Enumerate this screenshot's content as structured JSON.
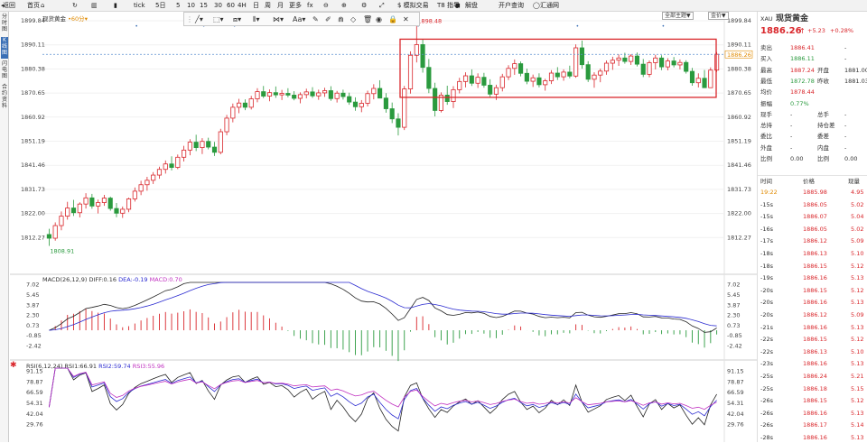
{
  "topbar": {
    "items": [
      "返回",
      "首页",
      "",
      "",
      "",
      "tick",
      "5日",
      "5",
      "10",
      "15",
      "30",
      "60",
      "4H",
      "日",
      "周",
      "月",
      "更多",
      "fx",
      "",
      "",
      "",
      "$ 模拟交易",
      "T8 指导",
      "解盘",
      "开户查询",
      "汇通网"
    ]
  },
  "left_tabs": [
    "分时图",
    "K线图",
    "闪电图",
    "合约资料"
  ],
  "chart": {
    "title": "现货黄金",
    "period": "60分",
    "price_axis": [
      "1899.84",
      "1890.11",
      "1880.38",
      "1870.65",
      "1860.92",
      "1851.19",
      "1841.46",
      "1831.73",
      "1822.00",
      "1812.27"
    ],
    "price_range": [
      1808.0,
      1899.84
    ],
    "current_price_tag": "1886.26",
    "high_label": "1898.48",
    "low_label": "1808.91",
    "select_main": "全部主题",
    "select_second": "金价"
  },
  "macd": {
    "label_name": "MACD(26,12,9)",
    "diff": "DIFF:0.16",
    "dea": "DEA:-0.19",
    "macd": "MACD:0.70",
    "axis": [
      "7.02",
      "5.45",
      "3.87",
      "2.30",
      "0.73",
      "-0.85",
      "-2.42"
    ],
    "range": [
      -3.2,
      7.4
    ]
  },
  "rsi": {
    "label_name": "RSI(6,12,24)",
    "rsi1": "RSI1:66.91",
    "rsi2": "RSI2:59.74",
    "rsi3": "RSI3:55.96",
    "axis": [
      "91.15",
      "78.87",
      "66.59",
      "54.31",
      "42.04",
      "29.76"
    ],
    "range": [
      22,
      95
    ]
  },
  "quote": {
    "code": "XAU",
    "name": "现货黄金",
    "price": "1886.26",
    "arrow": "↑",
    "change": "+5.23",
    "change_pct": "+0.28%",
    "rows": [
      {
        "l1": "卖出",
        "v1": "1886.41",
        "l2": "",
        "v2": "-"
      },
      {
        "l1": "买入",
        "v1": "1886.11",
        "l2": "",
        "v2": "-"
      },
      {
        "l1": "最高",
        "v1": "1887.24",
        "l2": "开盘",
        "v2": "1881.00"
      },
      {
        "l1": "最低",
        "v1": "1872.78",
        "l2": "昨收",
        "v2": "1881.03"
      },
      {
        "l1": "均价",
        "v1": "1878.44",
        "l2": "",
        "v2": ""
      },
      {
        "l1": "振幅",
        "v1": "0.77%",
        "l2": "",
        "v2": ""
      },
      {
        "l1": "现手",
        "v1": "-",
        "l2": "总手",
        "v2": "-"
      },
      {
        "l1": "总持",
        "v1": "-",
        "l2": "持仓差",
        "v2": "-"
      },
      {
        "l1": "委比",
        "v1": "-",
        "l2": "委差",
        "v2": "-"
      },
      {
        "l1": "外盘",
        "v1": "-",
        "l2": "内盘",
        "v2": "-"
      },
      {
        "l1": "比例",
        "v1": "0.00",
        "l2": "比例",
        "v2": "0.00"
      }
    ],
    "tick_headers": [
      "时间",
      "价格",
      "现量"
    ],
    "ticks": [
      {
        "t": "19:22",
        "p": "1885.98",
        "v": "4.95"
      },
      {
        "t": "-15s",
        "p": "1886.05",
        "v": "5.02"
      },
      {
        "t": "-15s",
        "p": "1886.07",
        "v": "5.04"
      },
      {
        "t": "-16s",
        "p": "1886.05",
        "v": "5.02"
      },
      {
        "t": "-17s",
        "p": "1886.12",
        "v": "5.09"
      },
      {
        "t": "-18s",
        "p": "1886.13",
        "v": "5.10"
      },
      {
        "t": "-18s",
        "p": "1886.15",
        "v": "5.12"
      },
      {
        "t": "-19s",
        "p": "1886.16",
        "v": "5.13"
      },
      {
        "t": "-20s",
        "p": "1886.15",
        "v": "5.12"
      },
      {
        "t": "-20s",
        "p": "1886.16",
        "v": "5.13"
      },
      {
        "t": "-20s",
        "p": "1886.12",
        "v": "5.09"
      },
      {
        "t": "-21s",
        "p": "1886.16",
        "v": "5.13"
      },
      {
        "t": "-22s",
        "p": "1886.15",
        "v": "5.12"
      },
      {
        "t": "-22s",
        "p": "1886.13",
        "v": "5.10"
      },
      {
        "t": "-23s",
        "p": "1886.16",
        "v": "5.13"
      },
      {
        "t": "-25s",
        "p": "1886.24",
        "v": "5.21"
      },
      {
        "t": "-25s",
        "p": "1886.18",
        "v": "5.15"
      },
      {
        "t": "-26s",
        "p": "1886.15",
        "v": "5.12"
      },
      {
        "t": "-26s",
        "p": "1886.16",
        "v": "5.13"
      },
      {
        "t": "-26s",
        "p": "1886.17",
        "v": "5.14"
      },
      {
        "t": "-28s",
        "p": "1886.16",
        "v": "5.13"
      }
    ]
  },
  "colors": {
    "up": "#d9262b",
    "down": "#2a9a3e",
    "highlight_box": "#d9262b",
    "diff_line": "#222222",
    "dea_line": "#2a2ad0"
  },
  "chart_data": {
    "type": "candlestick",
    "series": [
      {
        "name": "price",
        "ohlc": [
          [
            1813.5,
            1815.8,
            1808.9,
            1812.0
          ],
          [
            1812.0,
            1818.4,
            1811.0,
            1817.1
          ],
          [
            1817.1,
            1822.8,
            1815.2,
            1820.9
          ],
          [
            1820.9,
            1826.7,
            1819.5,
            1824.2
          ],
          [
            1824.2,
            1827.5,
            1821.0,
            1822.3
          ],
          [
            1822.3,
            1826.5,
            1820.4,
            1825.8
          ],
          [
            1825.8,
            1830.2,
            1824.0,
            1828.3
          ],
          [
            1828.3,
            1829.9,
            1823.9,
            1825.0
          ],
          [
            1825.0,
            1827.6,
            1822.0,
            1826.4
          ],
          [
            1826.4,
            1829.5,
            1825.1,
            1828.2
          ],
          [
            1828.2,
            1828.8,
            1823.1,
            1824.0
          ],
          [
            1824.0,
            1826.2,
            1820.5,
            1822.1
          ],
          [
            1822.1,
            1824.8,
            1820.2,
            1823.7
          ],
          [
            1823.7,
            1828.4,
            1822.5,
            1827.9
          ],
          [
            1827.9,
            1832.5,
            1826.8,
            1831.0
          ],
          [
            1831.0,
            1835.2,
            1829.4,
            1833.6
          ],
          [
            1833.6,
            1836.8,
            1831.2,
            1835.4
          ],
          [
            1835.4,
            1838.7,
            1833.9,
            1837.5
          ],
          [
            1837.5,
            1840.9,
            1836.0,
            1839.8
          ],
          [
            1839.8,
            1843.4,
            1838.1,
            1842.0
          ],
          [
            1842.0,
            1845.1,
            1839.4,
            1840.6
          ],
          [
            1840.6,
            1845.8,
            1839.9,
            1844.7
          ],
          [
            1844.7,
            1849.3,
            1843.0,
            1847.6
          ],
          [
            1847.6,
            1852.0,
            1845.5,
            1850.8
          ],
          [
            1850.8,
            1853.8,
            1847.2,
            1848.6
          ],
          [
            1848.6,
            1852.4,
            1846.0,
            1851.1
          ],
          [
            1851.1,
            1852.6,
            1847.9,
            1848.8
          ],
          [
            1848.8,
            1850.9,
            1845.2,
            1846.7
          ],
          [
            1846.7,
            1856.2,
            1845.9,
            1855.0
          ],
          [
            1855.0,
            1861.8,
            1853.6,
            1860.5
          ],
          [
            1860.5,
            1866.4,
            1858.8,
            1864.9
          ],
          [
            1864.9,
            1868.3,
            1862.5,
            1866.6
          ],
          [
            1866.6,
            1868.1,
            1863.7,
            1864.9
          ],
          [
            1864.9,
            1869.5,
            1864.0,
            1868.3
          ],
          [
            1868.3,
            1872.6,
            1866.9,
            1871.2
          ],
          [
            1871.2,
            1873.5,
            1868.6,
            1869.4
          ],
          [
            1869.4,
            1872.1,
            1867.3,
            1870.8
          ],
          [
            1870.8,
            1873.3,
            1868.7,
            1869.9
          ],
          [
            1869.9,
            1871.9,
            1867.8,
            1870.5
          ],
          [
            1870.5,
            1872.6,
            1868.9,
            1869.8
          ],
          [
            1869.8,
            1871.4,
            1867.7,
            1868.5
          ],
          [
            1868.5,
            1870.9,
            1866.5,
            1870.0
          ],
          [
            1870.0,
            1872.4,
            1868.5,
            1871.1
          ],
          [
            1871.1,
            1873.0,
            1868.7,
            1869.5
          ],
          [
            1869.5,
            1872.0,
            1867.9,
            1870.7
          ],
          [
            1870.7,
            1872.8,
            1869.1,
            1871.6
          ],
          [
            1871.6,
            1873.4,
            1867.5,
            1868.4
          ],
          [
            1868.4,
            1871.5,
            1866.8,
            1870.6
          ],
          [
            1870.6,
            1872.0,
            1868.0,
            1869.2
          ],
          [
            1869.2,
            1870.8,
            1865.9,
            1867.0
          ],
          [
            1867.0,
            1868.9,
            1863.5,
            1865.1
          ],
          [
            1865.1,
            1867.8,
            1862.9,
            1866.5
          ],
          [
            1866.5,
            1871.6,
            1865.2,
            1870.4
          ],
          [
            1870.4,
            1874.2,
            1868.1,
            1872.5
          ],
          [
            1872.5,
            1875.8,
            1870.2,
            1868.6
          ],
          [
            1868.6,
            1870.6,
            1862.7,
            1864.3
          ],
          [
            1864.3,
            1866.8,
            1858.5,
            1860.2
          ],
          [
            1860.2,
            1862.5,
            1853.5,
            1856.8
          ],
          [
            1856.8,
            1873.5,
            1855.7,
            1872.3
          ],
          [
            1872.3,
            1887.5,
            1870.4,
            1885.9
          ],
          [
            1885.9,
            1898.5,
            1883.0,
            1890.2
          ],
          [
            1890.2,
            1892.5,
            1878.9,
            1881.0
          ],
          [
            1881.0,
            1884.4,
            1870.6,
            1872.5
          ],
          [
            1872.5,
            1874.8,
            1861.2,
            1863.6
          ],
          [
            1863.6,
            1870.9,
            1862.8,
            1869.8
          ],
          [
            1869.8,
            1873.6,
            1865.9,
            1867.2
          ],
          [
            1867.2,
            1873.4,
            1864.6,
            1872.0
          ],
          [
            1872.0,
            1876.8,
            1870.5,
            1875.3
          ],
          [
            1875.3,
            1879.0,
            1872.9,
            1877.6
          ],
          [
            1877.6,
            1880.2,
            1873.5,
            1874.6
          ],
          [
            1874.6,
            1878.6,
            1872.7,
            1877.0
          ],
          [
            1877.0,
            1878.8,
            1872.8,
            1873.8
          ],
          [
            1873.8,
            1876.2,
            1868.8,
            1870.2
          ],
          [
            1870.2,
            1874.0,
            1867.8,
            1872.8
          ],
          [
            1872.8,
            1878.4,
            1871.3,
            1877.2
          ],
          [
            1877.2,
            1881.9,
            1875.9,
            1880.6
          ],
          [
            1880.6,
            1884.2,
            1878.0,
            1882.5
          ],
          [
            1882.5,
            1883.4,
            1877.4,
            1878.6
          ],
          [
            1878.6,
            1880.5,
            1874.2,
            1875.4
          ],
          [
            1875.4,
            1878.1,
            1873.1,
            1876.8
          ],
          [
            1876.8,
            1878.6,
            1872.9,
            1874.0
          ],
          [
            1874.0,
            1876.4,
            1871.6,
            1875.6
          ],
          [
            1875.6,
            1879.9,
            1874.3,
            1878.7
          ],
          [
            1878.7,
            1881.1,
            1875.9,
            1877.2
          ],
          [
            1877.2,
            1880.2,
            1875.6,
            1879.1
          ],
          [
            1879.1,
            1881.7,
            1876.6,
            1877.5
          ],
          [
            1877.5,
            1890.3,
            1876.8,
            1888.9
          ],
          [
            1888.9,
            1891.8,
            1880.5,
            1882.1
          ],
          [
            1882.1,
            1883.5,
            1875.1,
            1876.2
          ],
          [
            1876.2,
            1879.0,
            1872.8,
            1877.9
          ],
          [
            1877.9,
            1880.5,
            1875.0,
            1879.5
          ],
          [
            1879.5,
            1883.8,
            1878.0,
            1882.7
          ],
          [
            1882.7,
            1885.3,
            1880.0,
            1883.9
          ],
          [
            1883.9,
            1886.2,
            1881.6,
            1884.8
          ],
          [
            1884.8,
            1886.9,
            1882.5,
            1883.4
          ],
          [
            1883.4,
            1886.3,
            1882.0,
            1885.6
          ],
          [
            1885.6,
            1887.0,
            1881.4,
            1882.3
          ],
          [
            1882.3,
            1884.4,
            1877.1,
            1878.2
          ],
          [
            1878.2,
            1883.8,
            1877.0,
            1882.9
          ],
          [
            1882.9,
            1886.1,
            1880.2,
            1884.8
          ],
          [
            1884.8,
            1885.9,
            1879.9,
            1881.2
          ],
          [
            1881.2,
            1884.7,
            1879.8,
            1883.6
          ],
          [
            1883.6,
            1885.2,
            1881.0,
            1882.0
          ],
          [
            1882.0,
            1884.2,
            1880.2,
            1883.0
          ],
          [
            1883.0,
            1883.9,
            1878.5,
            1879.4
          ],
          [
            1879.4,
            1880.8,
            1873.6,
            1874.8
          ],
          [
            1874.8,
            1878.6,
            1872.9,
            1876.6
          ],
          [
            1876.6,
            1880.0,
            1874.6,
            1872.8
          ],
          [
            1872.8,
            1881.0,
            1872.8,
            1879.9
          ],
          [
            1879.9,
            1887.2,
            1879.2,
            1886.3
          ]
        ]
      }
    ]
  }
}
